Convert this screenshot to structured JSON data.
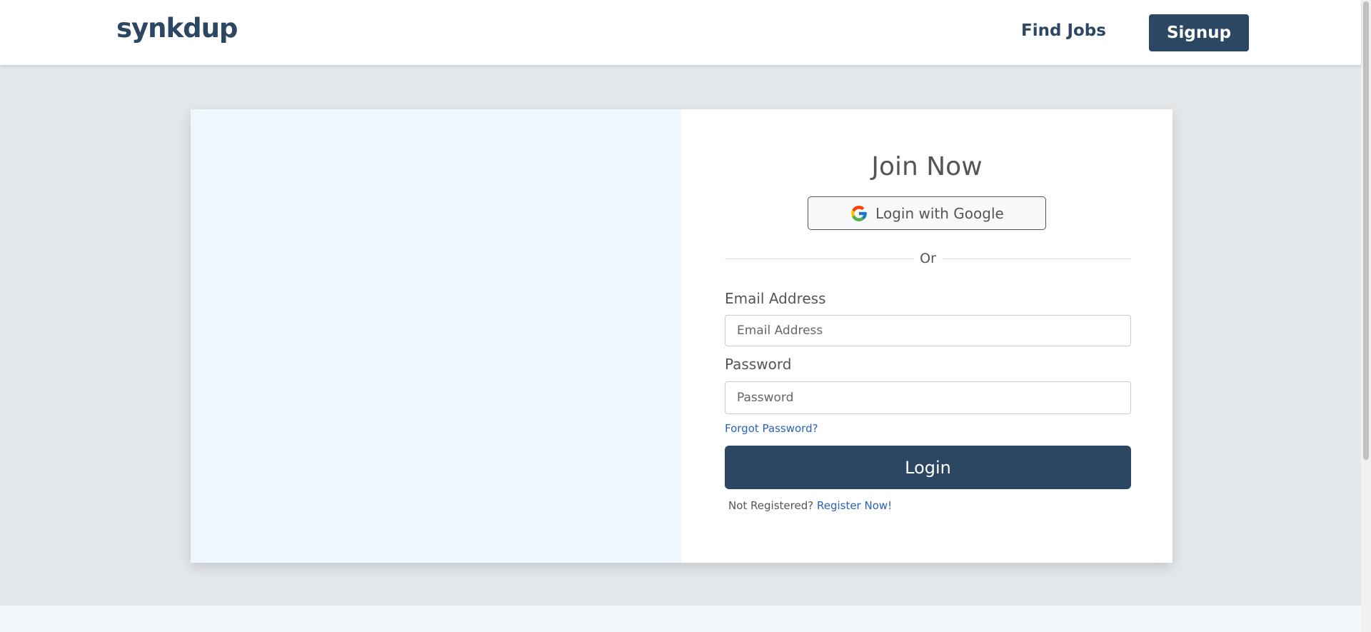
{
  "header": {
    "logo": "synkdup",
    "nav_find_jobs": "Find Jobs",
    "signup_label": "Signup"
  },
  "form": {
    "title": "Join Now",
    "google_label": "Login with Google",
    "or_text": "Or",
    "email_label": "Email Address",
    "email_placeholder": "Email Address",
    "password_label": "Password",
    "password_placeholder": "Password",
    "forgot_label": "Forgot Password?",
    "login_label": "Login",
    "not_registered": "Not Registered?",
    "register_label": "Register Now!"
  },
  "colors": {
    "brand": "#2c4763",
    "link": "#2a62b9",
    "page_bg": "#e4e8eb",
    "panel_bg": "#f0f6fd"
  },
  "icons": {
    "google": "google-g-icon"
  }
}
